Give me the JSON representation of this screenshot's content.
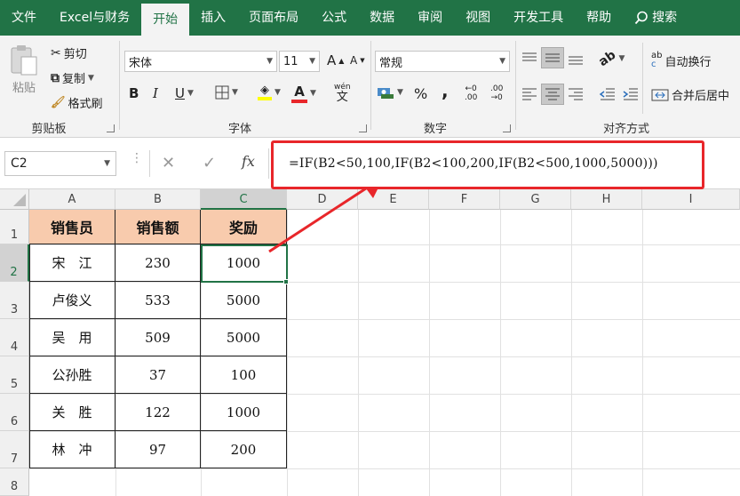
{
  "menu": {
    "tabs": [
      "文件",
      "Excel与财务",
      "开始",
      "插入",
      "页面布局",
      "公式",
      "数据",
      "审阅",
      "视图",
      "开发工具",
      "帮助"
    ],
    "active": "开始",
    "search_label": "搜索"
  },
  "ribbon": {
    "clipboard": {
      "paste": "粘贴",
      "cut": "剪切",
      "copy": "复制",
      "format_painter": "格式刷",
      "group": "剪贴板"
    },
    "font": {
      "name": "宋体",
      "size": "11",
      "grow": "A",
      "shrink": "A",
      "bold": "B",
      "italic": "I",
      "underline": "U",
      "font_color": "A",
      "phonetic_top": "wén",
      "phonetic_bottom": "文",
      "group": "字体"
    },
    "number": {
      "format": "常规",
      "percent": "%",
      "comma": ",",
      "inc_top": "←0",
      "inc_bottom": ".00",
      "dec_top": ".00",
      "dec_bottom": "→0",
      "group": "数字"
    },
    "alignment": {
      "wrap": "自动换行",
      "merge": "合并后居中",
      "wrap_icon": "ab",
      "wrap_icon2": "c",
      "group": "对齐方式"
    }
  },
  "formula_bar": {
    "name_box": "C2",
    "cancel": "✕",
    "enter": "✓",
    "fx": "fx",
    "formula": "=IF(B2<50,100,IF(B2<100,200,IF(B2<500,1000,5000)))"
  },
  "grid": {
    "columns": [
      "A",
      "B",
      "C",
      "D",
      "E",
      "F",
      "G",
      "H",
      "I"
    ],
    "rows": [
      "1",
      "2",
      "3",
      "4",
      "5",
      "6",
      "7",
      "8"
    ],
    "headers": [
      "销售员",
      "销售额",
      "奖励"
    ],
    "data": [
      [
        "宋　江",
        "230",
        "1000"
      ],
      [
        "卢俊义",
        "533",
        "5000"
      ],
      [
        "吴　用",
        "509",
        "5000"
      ],
      [
        "公孙胜",
        "37",
        "100"
      ],
      [
        "关　胜",
        "122",
        "1000"
      ],
      [
        "林　冲",
        "97",
        "200"
      ]
    ],
    "selected_cell": "C2"
  },
  "colors": {
    "excel_green": "#217346",
    "header_fill": "#f8cbad",
    "annotation_red": "#e8262a"
  }
}
